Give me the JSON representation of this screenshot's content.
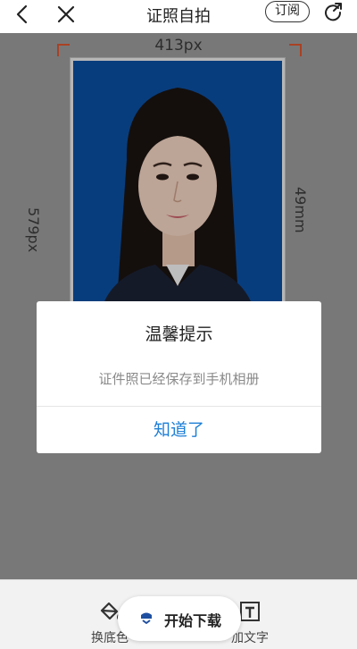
{
  "header": {
    "title": "证照自拍",
    "subscribe_label": "订阅",
    "icons": [
      "back-icon",
      "close-icon",
      "share-icon"
    ]
  },
  "editor": {
    "width_label": "413px",
    "height_px_label": "579px",
    "height_mm_label": "49mm",
    "background_color": "#0b4fa0"
  },
  "dialog": {
    "title": "温馨提示",
    "message": "证件照已经保存到手机相册",
    "confirm_label": "知道了",
    "accent": "#1e7fd6"
  },
  "toolbar": {
    "change_bg_label": "换底色",
    "add_text_label": "加文字",
    "download_label": "开始下载"
  }
}
